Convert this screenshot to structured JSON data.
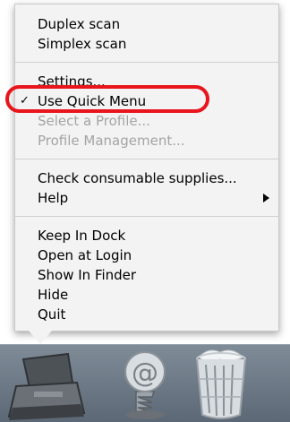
{
  "menu": {
    "items": [
      {
        "label": "Duplex scan",
        "enabled": true
      },
      {
        "label": "Simplex scan",
        "enabled": true
      },
      {
        "label": "Settings...",
        "enabled": true
      },
      {
        "label": "Use Quick Menu",
        "enabled": true,
        "checked": true,
        "highlighted": true
      },
      {
        "label": "Select a Profile...",
        "enabled": false
      },
      {
        "label": "Profile Management...",
        "enabled": false
      },
      {
        "label": "Check consumable supplies...",
        "enabled": true
      },
      {
        "label": "Help",
        "enabled": true,
        "has_submenu": true
      },
      {
        "label": "Keep In Dock",
        "enabled": true
      },
      {
        "label": "Open at Login",
        "enabled": true
      },
      {
        "label": "Show In Finder",
        "enabled": true
      },
      {
        "label": "Hide",
        "enabled": true
      },
      {
        "label": "Quit",
        "enabled": true
      }
    ],
    "check_glyph": "✓"
  },
  "highlight": {
    "color": "#e8151d"
  },
  "dock": {
    "icons": [
      {
        "name": "scanner-icon"
      },
      {
        "name": "mail-icon"
      },
      {
        "name": "trash-icon"
      }
    ]
  }
}
